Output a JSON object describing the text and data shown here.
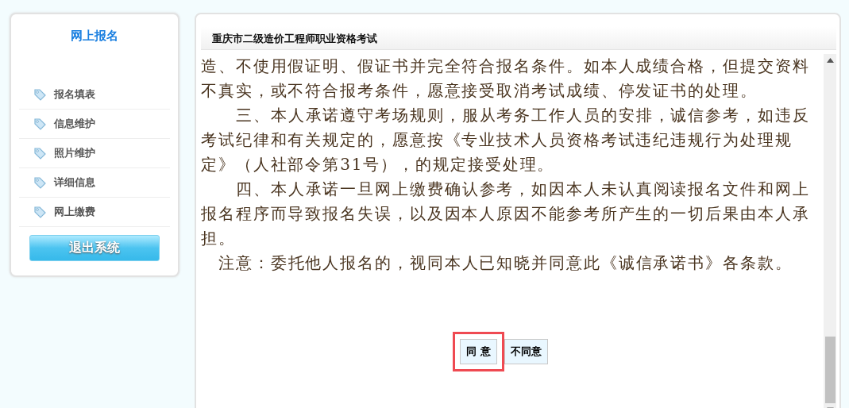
{
  "sidebar": {
    "title": "网上报名",
    "items": [
      {
        "label": "报名填表"
      },
      {
        "label": "信息维护"
      },
      {
        "label": "照片维护"
      },
      {
        "label": "详细信息"
      },
      {
        "label": "网上缴费"
      }
    ],
    "logout_button": "退出系统"
  },
  "main": {
    "title": "重庆市二级造价工程师职业资格考试",
    "lines": [
      {
        "kind": "plain",
        "text": "造、不使用假证明、假证书并完全符合报名条件。如本人成绩合格，但提交资料"
      },
      {
        "kind": "plain",
        "text": "不真实，或不符合报考条件，愿意接受取消考试成绩、停发证书的处理。"
      },
      {
        "kind": "indent2",
        "text": "三、本人承诺遵守考场规则，服从考务工作人员的安排，诚信参考，如违反"
      },
      {
        "kind": "plain",
        "text": "考试纪律和有关规定的，愿意按《专业技术人员资格考试违纪违规行为处理规"
      },
      {
        "kind": "plain",
        "text": "定》（人社部令第31号），的规定接受处理。"
      },
      {
        "kind": "indent2",
        "text": "四、本人承诺一旦网上缴费确认参考，如因本人未认真阅读报名文件和网上"
      },
      {
        "kind": "plain",
        "text": "报名程序而导致报名失误，以及因本人原因不能参考所产生的一切后果由本人承"
      },
      {
        "kind": "plain",
        "text": "担。"
      },
      {
        "kind": "indent1",
        "text": "注意：委托他人报名的，视同本人已知晓并同意此《诚信承诺书》各条款。"
      }
    ],
    "buttons": [
      {
        "label": "同 意",
        "highlighted": true
      },
      {
        "label": "不同意",
        "highlighted": false
      }
    ]
  }
}
